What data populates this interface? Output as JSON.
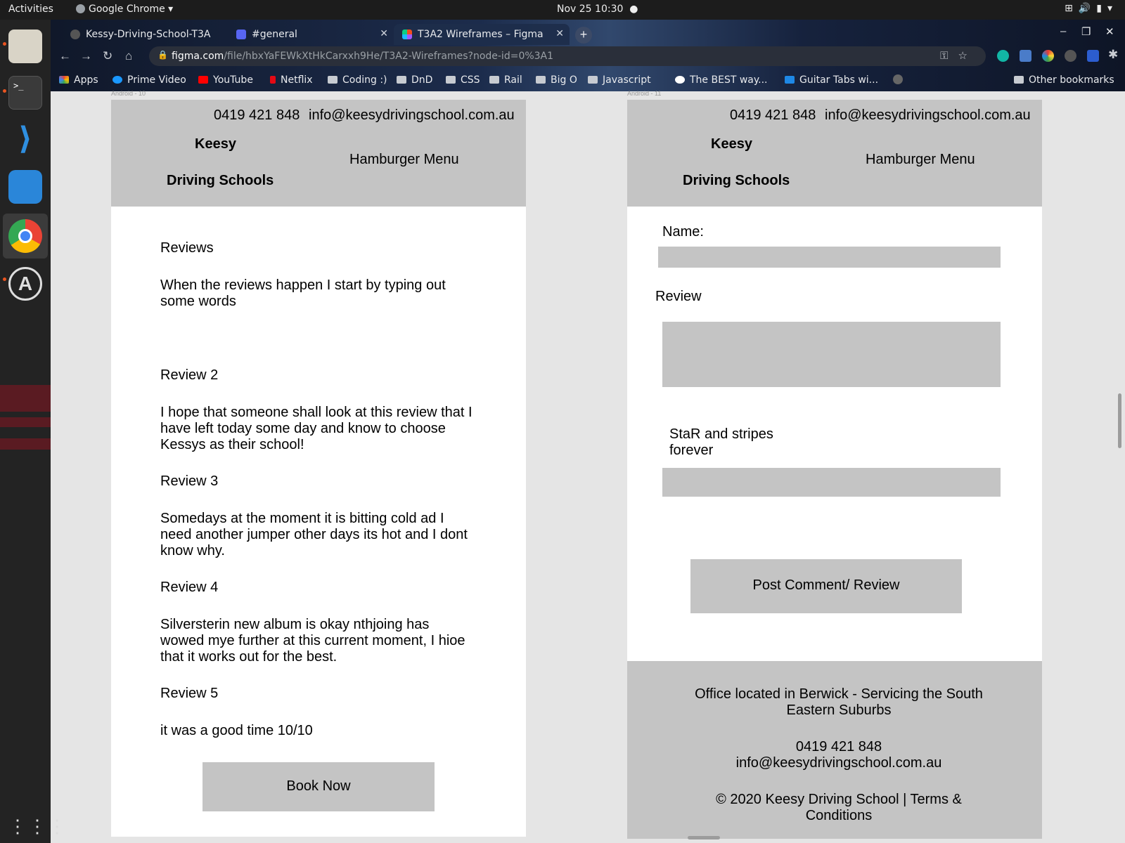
{
  "os_bar": {
    "activities": "Activities",
    "app_name": "Google Chrome ▾",
    "clock": "Nov 25  10:30"
  },
  "dock": {
    "items": [
      "files-icon",
      "terminal-icon",
      "vscode-icon",
      "software-store-icon",
      "chrome-icon",
      "software-updater-icon"
    ],
    "show_apps": "⋮⋮⋮"
  },
  "browser": {
    "tabs": [
      {
        "title": "Kessy-Driving-School-T3A"
      },
      {
        "title": "#general"
      },
      {
        "title": "T3A2 Wireframes – Figma"
      }
    ],
    "address": {
      "host": "figma.com",
      "path": "/file/hbxYaFEWkXtHkCarxxh9He/T3A2-Wireframes?node-id=0%3A1"
    },
    "bookmarks": [
      "Apps",
      "Prime Video",
      "YouTube",
      "Netflix",
      "Coding :)",
      "DnD",
      "CSS",
      "Rail",
      "Big O",
      "Javascript",
      "The BEST way...",
      "Guitar Tabs wi..."
    ],
    "other_bookmarks": "Other bookmarks",
    "profile_initial": "A"
  },
  "figma": {
    "frame_labels": [
      "Android - 10",
      "Android - 11"
    ],
    "header": {
      "phone": "0419 421 848",
      "email": "info@keesydrivingschool.com.au",
      "brand_line1": "Keesy",
      "brand_line2": "Driving Schools",
      "menu": "Hamburger Menu"
    },
    "reviews_frame": {
      "items": [
        {
          "heading": "Reviews",
          "body": "When the reviews happen I start by typing out some words"
        },
        {
          "heading": "Review 2",
          "body": "I hope that someone shall look at this review that I have left today some day and know to choose Kessys as their school!"
        },
        {
          "heading": "Review 3",
          "body": "Somedays at the moment it is bitting cold ad I need another jumper other days its hot and I dont know why."
        },
        {
          "heading": "Review 4",
          "body": "Silversterin new album is okay nthjoing has wowed mye further at this  current moment, I hioe that it works out for the best."
        },
        {
          "heading": "Review 5",
          "body": "it was a good time 10/10"
        }
      ],
      "book_button": "Book Now"
    },
    "form_frame": {
      "name_label": "Name:",
      "review_label": "Review",
      "stars_label": "StaR and stripes forever",
      "post_button": "Post Comment/ Review"
    },
    "footer": {
      "location": "Office located in Berwick - Servicing the South Eastern Suburbs",
      "phone": "0419 421 848",
      "email": "info@keesydrivingschool.com.au",
      "copyright": "© 2020 Keesy Driving School | Terms & Conditions"
    }
  },
  "colors": {
    "wireframe_gray": "#c4c4c4",
    "canvas_bg": "#e5e5e5",
    "ubuntu_accent": "#e95420"
  }
}
